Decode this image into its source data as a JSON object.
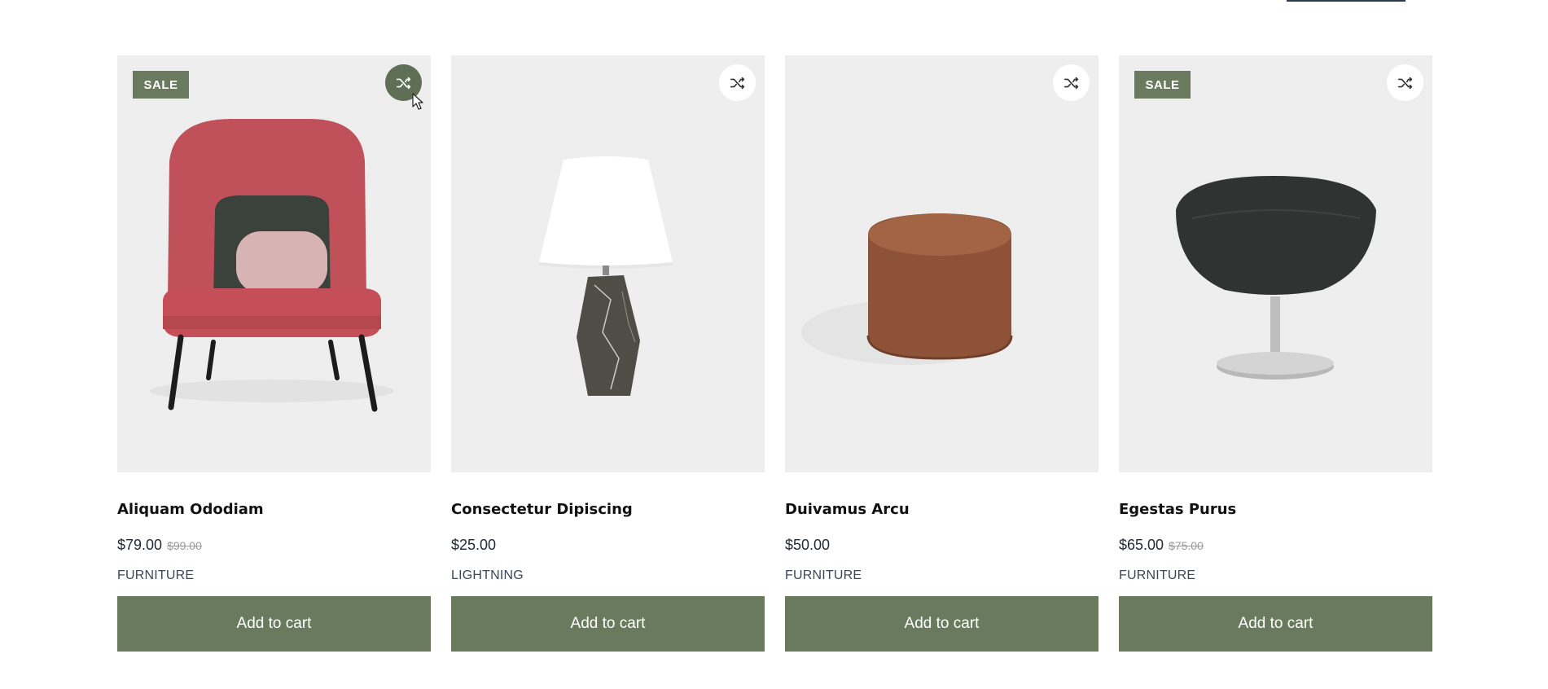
{
  "products": [
    {
      "title": "Aliquam Ododiam",
      "price": "$79.00",
      "old_price": "$99.00",
      "category": "FURNITURE",
      "badge": "SALE",
      "cart_label": "Add to cart",
      "image": "red-lounge-chair"
    },
    {
      "title": "Consectetur Dipiscing",
      "price": "$25.00",
      "old_price": "",
      "category": "LIGHTNING",
      "badge": "",
      "cart_label": "Add to cart",
      "image": "marble-table-lamp"
    },
    {
      "title": "Duivamus Arcu",
      "price": "$50.00",
      "old_price": "",
      "category": "FURNITURE",
      "badge": "",
      "cart_label": "Add to cart",
      "image": "brown-pouf"
    },
    {
      "title": "Egestas Purus",
      "price": "$65.00",
      "old_price": "$75.00",
      "category": "FURNITURE",
      "badge": "SALE",
      "cart_label": "Add to cart",
      "image": "black-swivel-chair"
    }
  ],
  "colors": {
    "accent": "#6a7a5e",
    "image_bg": "#eeeeee",
    "compare_active": "#5f6f55"
  },
  "icons": {
    "compare": "shuffle-icon",
    "cursor": "mouse-pointer-icon"
  }
}
